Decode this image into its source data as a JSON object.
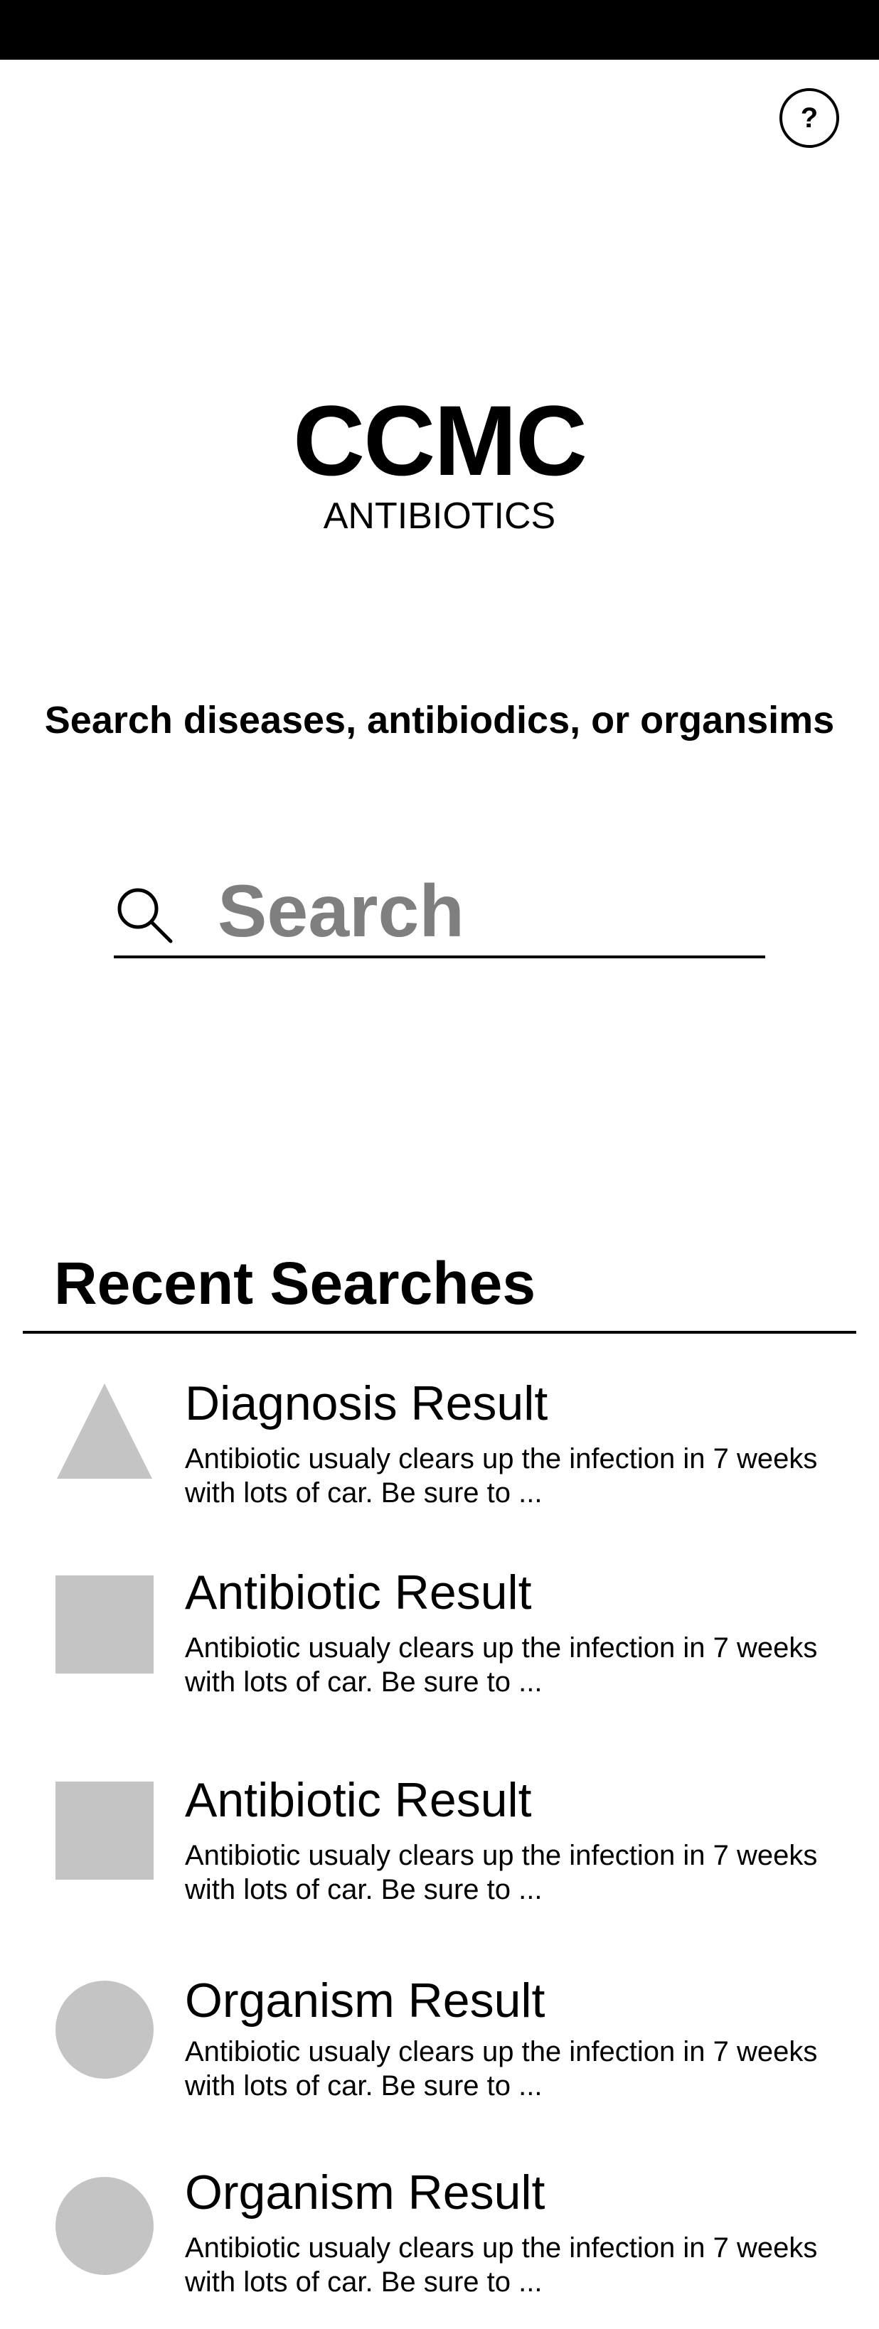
{
  "header": {
    "help_label": "?"
  },
  "brand": {
    "title": "CCMC",
    "subtitle": "ANTIBIOTICS"
  },
  "search": {
    "prompt": "Search diseases, antibiodics, or organsims",
    "placeholder": "Search",
    "icon": "search-icon"
  },
  "recent": {
    "heading": "Recent Searches",
    "items": [
      {
        "shape": "triangle",
        "title": "Diagnosis Result",
        "description": "Antibiotic usualy clears up the infection in 7 weeks with lots of car. Be sure to ..."
      },
      {
        "shape": "square",
        "title": "Antibiotic Result",
        "description": "Antibiotic usualy clears up the infection in 7 weeks with lots of car. Be sure to ..."
      },
      {
        "shape": "square",
        "title": "Antibiotic Result",
        "description": "Antibiotic usualy clears up the infection in 7 weeks with lots of car. Be sure to ..."
      },
      {
        "shape": "circle",
        "title": "Organism Result",
        "description": "Antibiotic usualy clears up the infection in 7 weeks with lots of car. Be sure to ..."
      },
      {
        "shape": "circle",
        "title": "Organism Result",
        "description": "Antibiotic usualy clears up the infection in 7 weeks with lots of car. Be sure to ..."
      }
    ]
  },
  "colors": {
    "status_bar": "#000000",
    "shape_fill": "#c4c4c4",
    "placeholder_text": "#7f7f7f"
  }
}
